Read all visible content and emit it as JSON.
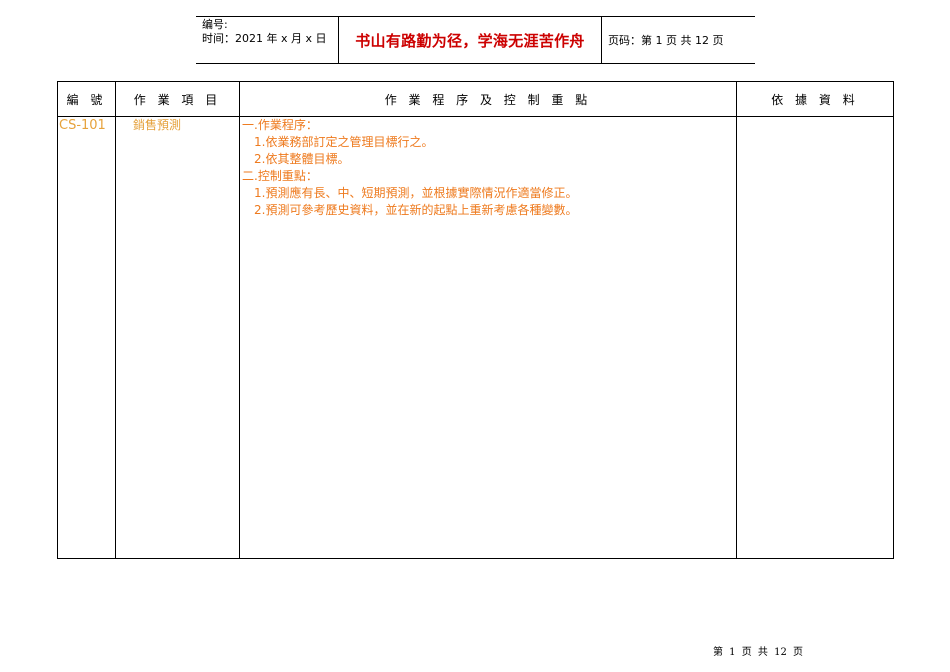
{
  "header": {
    "code_label": "编号:",
    "time_label": "时间：2021 年 x 月 x 日",
    "motto": "书山有路勤为径，学海无涯苦作舟",
    "page_info": "页码：第 1 页  共 12 页",
    "motto_color": "#cc0000"
  },
  "table": {
    "columns": [
      "編 號",
      "作 業 項 目",
      "作 業 程 序 及 控 制 重 點",
      "依 據 資 料"
    ],
    "rows": [
      {
        "code": "CS-101",
        "item": "銷售預測",
        "content": [
          "一.作業程序：",
          "1.依業務部訂定之管理目標行之。",
          "2.依其整體目標。",
          "二.控制重點：",
          "1.預測應有長、中、短期預測，並根據實際情況作適當修正。",
          "2.預測可參考歷史資料，並在新的起點上重新考慮各種變數。"
        ],
        "reference": ""
      }
    ],
    "colors": {
      "code": "#e6a23c",
      "item": "#e5a03a",
      "content": "#ee7a1e"
    }
  },
  "footer": {
    "page_text": "第 1 页 共 12 页"
  }
}
